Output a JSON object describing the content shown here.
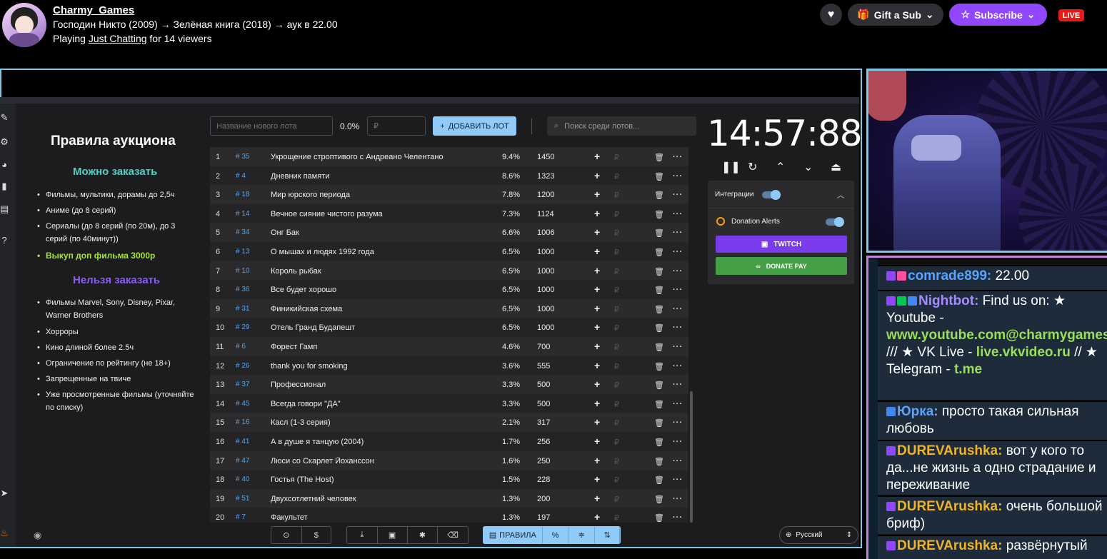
{
  "header": {
    "channel_name": "Charmy_Games",
    "stream_title": "Господин Никто (2009) → Зелёная книга (2018) → аук в 22.00",
    "playing_prefix": "Playing",
    "category": "Just Chatting",
    "viewers_text": "for 14 viewers",
    "gift_label": "Gift a Sub",
    "subscribe_label": "Subscribe",
    "live_badge": "LIVE",
    "accent_color": "#9147ff",
    "live_color": "#e91916"
  },
  "rules": {
    "title": "Правила аукциона",
    "can_title": "Можно заказать",
    "can_items": [
      "Фильмы, мультики, дорамы до 2,5ч",
      "Аниме (до 8 серий)",
      "Сериалы (до 8 серий (по 20м), до 3 серий (по 40минут))",
      "Выкуп доп фильма 3000р"
    ],
    "cant_title": "Нельзя заказать",
    "cant_items": [
      "Фильмы Marvel, Sony, Disney, Pixar, Warner Brothers",
      "Хорроры",
      "Кино длиной более 2.5ч",
      "Ограничение по рейтингу (не 18+)",
      "Запрещенные на твиче",
      "Уже просмотренные фильмы (уточняйте по списку)"
    ]
  },
  "controls": {
    "name_placeholder": "Название нового лота",
    "percent": "0.0%",
    "amount_placeholder": "₽",
    "add_label": "ДОБАВИТЬ ЛОТ",
    "search_placeholder": "Поиск среди лотов..."
  },
  "lots": [
    {
      "n": "1",
      "id": "# 35",
      "name": "Укрощение строптивого с Андреано Челентано",
      "pct": "9.4%",
      "amount": "1450"
    },
    {
      "n": "2",
      "id": "# 4",
      "name": "Дневник памяти",
      "pct": "8.6%",
      "amount": "1323"
    },
    {
      "n": "3",
      "id": "# 18",
      "name": "Мир юрского периода",
      "pct": "7.8%",
      "amount": "1200"
    },
    {
      "n": "4",
      "id": "# 14",
      "name": "Вечное сияние чистого разума",
      "pct": "7.3%",
      "amount": "1124"
    },
    {
      "n": "5",
      "id": "# 34",
      "name": "Онг Бак",
      "pct": "6.6%",
      "amount": "1006"
    },
    {
      "n": "6",
      "id": "# 13",
      "name": "О мышах и людях 1992 года",
      "pct": "6.5%",
      "amount": "1000"
    },
    {
      "n": "7",
      "id": "# 10",
      "name": "Король рыбак",
      "pct": "6.5%",
      "amount": "1000"
    },
    {
      "n": "8",
      "id": "# 36",
      "name": "Все будет хорошо",
      "pct": "6.5%",
      "amount": "1000"
    },
    {
      "n": "9",
      "id": "# 31",
      "name": "Финикийская схема",
      "pct": "6.5%",
      "amount": "1000"
    },
    {
      "n": "10",
      "id": "# 29",
      "name": "Отель Гранд Будапешт",
      "pct": "6.5%",
      "amount": "1000"
    },
    {
      "n": "11",
      "id": "# 6",
      "name": "Форест Гамп",
      "pct": "4.6%",
      "amount": "700"
    },
    {
      "n": "12",
      "id": "# 26",
      "name": "thank you for smoking",
      "pct": "3.6%",
      "amount": "555"
    },
    {
      "n": "13",
      "id": "# 37",
      "name": "Профессионал",
      "pct": "3.3%",
      "amount": "500"
    },
    {
      "n": "14",
      "id": "# 45",
      "name": "Всегда говори \"ДА\"",
      "pct": "3.3%",
      "amount": "500"
    },
    {
      "n": "15",
      "id": "# 16",
      "name": "Касл (1-3 серия)",
      "pct": "2.1%",
      "amount": "317"
    },
    {
      "n": "16",
      "id": "# 41",
      "name": "А в душе я танцую (2004)",
      "pct": "1.7%",
      "amount": "256"
    },
    {
      "n": "17",
      "id": "# 47",
      "name": "Люси со Скарлет Йохансcон",
      "pct": "1.6%",
      "amount": "250"
    },
    {
      "n": "18",
      "id": "# 40",
      "name": "Гостья (The Host)",
      "pct": "1.5%",
      "amount": "228"
    },
    {
      "n": "19",
      "id": "# 51",
      "name": "Двухсотлетний человек",
      "pct": "1.3%",
      "amount": "200"
    },
    {
      "n": "20",
      "id": "# 7",
      "name": "Факультет",
      "pct": "1.3%",
      "amount": "197"
    }
  ],
  "timer": {
    "value": "14:57:88"
  },
  "integrations": {
    "label": "Интеграции",
    "donation_alerts": "Donation Alerts",
    "twitch_label": "TWITCH",
    "donatepay_label": "DONATE PAY"
  },
  "toolbar": {
    "rules_label": "ПРАВИЛА",
    "language": "Русский"
  },
  "chat": [
    {
      "user": "comrade899",
      "sep": ":",
      "text": " 22.00"
    },
    {
      "user": "Nightbot",
      "sep": ":",
      "parts": [
        " Find us on: ★ Youtube - ",
        "www.youtube.com@charmygames_",
        " /// ★ VK Live - ",
        "live.vkvideo.ru",
        " // ★ Telegram - ",
        "t.me"
      ]
    },
    {
      "user": "Юрка",
      "sep": ":",
      "text": " просто такая сильная любовь"
    },
    {
      "user": "DUREVArushka",
      "sep": ":",
      "text": " вот у кого то да...не жизнь а одно страдание и переживание"
    },
    {
      "user": "DUREVArushka",
      "sep": ":",
      "text": " очень большой бриф)"
    },
    {
      "user": "DUREVArushka",
      "sep": ":",
      "text": " развёрнутый"
    }
  ]
}
